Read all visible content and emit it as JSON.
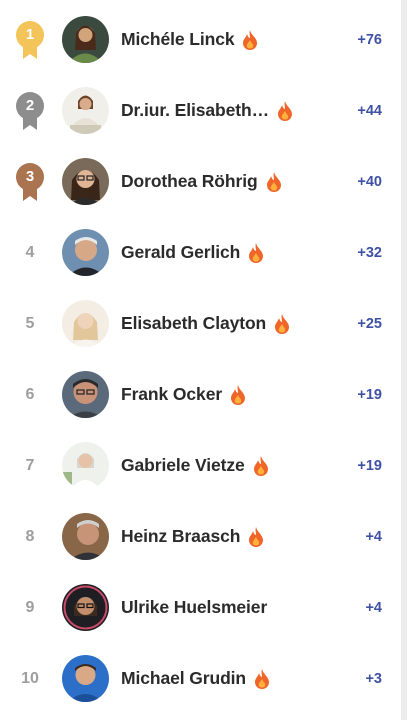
{
  "leaderboard": {
    "entries": [
      {
        "rank": "1",
        "name": "Michéle Linck",
        "score": "+76",
        "fire": true,
        "avatar_icon": "user-avatar-icon"
      },
      {
        "rank": "2",
        "name": "Dr.iur. Elisabeth…",
        "score": "+44",
        "fire": true,
        "avatar_icon": "user-avatar-icon"
      },
      {
        "rank": "3",
        "name": "Dorothea Röhrig",
        "score": "+40",
        "fire": true,
        "avatar_icon": "user-avatar-icon"
      },
      {
        "rank": "4",
        "name": "Gerald Gerlich",
        "score": "+32",
        "fire": true,
        "avatar_icon": "user-avatar-icon"
      },
      {
        "rank": "5",
        "name": "Elisabeth Clayton",
        "score": "+25",
        "fire": true,
        "avatar_icon": "user-avatar-icon"
      },
      {
        "rank": "6",
        "name": "Frank Ocker",
        "score": "+19",
        "fire": true,
        "avatar_icon": "user-avatar-icon"
      },
      {
        "rank": "7",
        "name": "Gabriele Vietze",
        "score": "+19",
        "fire": true,
        "avatar_icon": "user-avatar-icon"
      },
      {
        "rank": "8",
        "name": "Heinz Braasch",
        "score": "+4",
        "fire": true,
        "avatar_icon": "user-avatar-icon"
      },
      {
        "rank": "9",
        "name": "Ulrike Huelsmeier",
        "score": "+4",
        "fire": false,
        "avatar_icon": "user-avatar-icon"
      },
      {
        "rank": "10",
        "name": "Michael Grudin",
        "score": "+3",
        "fire": true,
        "avatar_icon": "user-avatar-icon"
      }
    ]
  },
  "colors": {
    "gold": "#f2c45a",
    "silver": "#8d8d8d",
    "bronze": "#a9744f",
    "score": "#3f51a5",
    "rank_text": "#9e9e9e",
    "fire": "#f0662a"
  }
}
